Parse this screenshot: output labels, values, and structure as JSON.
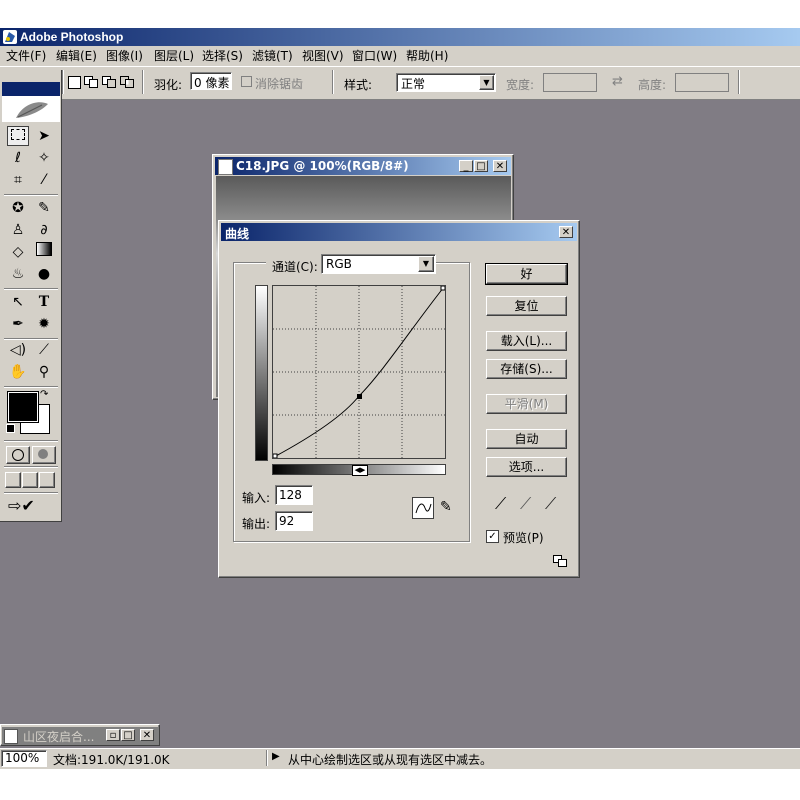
{
  "app": {
    "title": "Adobe Photoshop"
  },
  "menu": [
    {
      "label": "文件(F)"
    },
    {
      "label": "编辑(E)"
    },
    {
      "label": "图像(I)"
    },
    {
      "label": "图层(L)"
    },
    {
      "label": "选择(S)"
    },
    {
      "label": "滤镜(T)"
    },
    {
      "label": "视图(V)"
    },
    {
      "label": "窗口(W)"
    },
    {
      "label": "帮助(H)"
    }
  ],
  "options_bar": {
    "feather_label": "羽化:",
    "feather_value": "0 像素",
    "antialias_label": "消除锯齿",
    "style_label": "样式:",
    "style_value": "正常",
    "width_label": "宽度:",
    "height_label": "高度:"
  },
  "document": {
    "title": "C18.JPG @ 100%(RGB/8#)"
  },
  "curves": {
    "title": "曲线",
    "channel_label": "通道(C):",
    "channel_value": "RGB",
    "input_label": "输入:",
    "input_value": "128",
    "output_label": "输出:",
    "output_value": "92",
    "buttons": {
      "ok": "好",
      "reset": "复位",
      "load": "载入(L)...",
      "save": "存储(S)...",
      "smooth": "平滑(M)",
      "auto": "自动",
      "options": "选项..."
    },
    "preview_label": "预览(P)",
    "preview_checked": true
  },
  "minimized_window": {
    "title": "山区夜启合..."
  },
  "status_bar": {
    "zoom": "100%",
    "doc_info": "文档:191.0K/191.0K",
    "hint": "从中心绘制选区或从现有选区中减去。"
  },
  "colors": {
    "workspace": "#807c84",
    "title_active": "#0a246a",
    "title_gradient_end": "#a6caf0",
    "face": "#d4d0c8"
  }
}
